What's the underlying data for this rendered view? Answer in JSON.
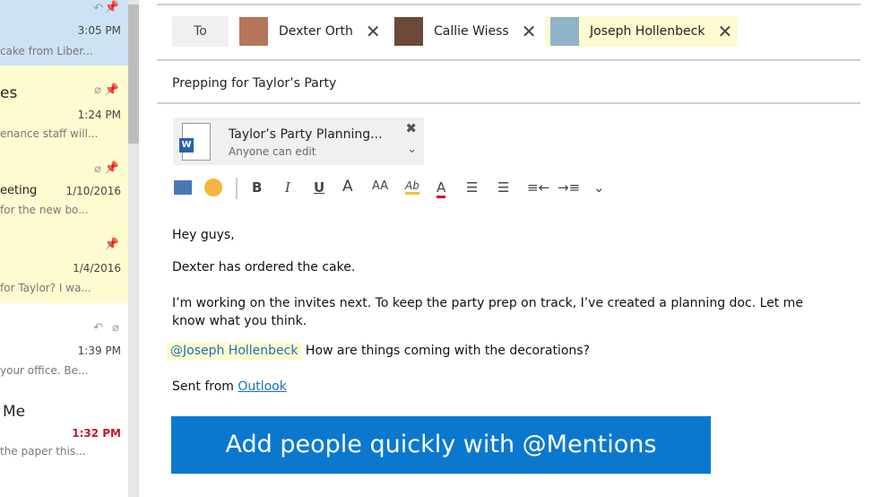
{
  "messages": [
    {
      "time": "3:05 PM",
      "preview": "cake from Liber..."
    },
    {
      "title": "es",
      "time": "1:24 PM",
      "preview": "enance staff will..."
    },
    {
      "title": "eeting",
      "time": "1/10/2016",
      "preview": "for the new bo..."
    },
    {
      "time": "1/4/2016",
      "preview": "for Taylor? I wa..."
    },
    {
      "time": "1:39 PM",
      "preview": "your office. Be..."
    },
    {
      "title": "Me",
      "time": "1:32 PM",
      "preview": "the paper this..."
    }
  ],
  "compose": {
    "to_label": "To",
    "recipients": [
      "Dexter Orth",
      "Callie Wiess",
      "Joseph Hollenbeck"
    ],
    "subject": "Prepping for Taylor’s Party",
    "attachment": {
      "name": "Taylor’s Party Planning...",
      "permission": "Anyone can edit"
    },
    "toolbar": [
      "B",
      "I",
      "U",
      "A",
      "AA",
      "Ab",
      "A"
    ],
    "body": {
      "greeting": "Hey guys,",
      "line1": "Dexter has ordered the cake.",
      "line2": "I’m working on the invites next. To keep the party prep on track, I’ve created a planning doc. Let me know what you think.",
      "mention": "@Joseph Hollenbeck",
      "mention_text": " How are things coming with the decorations?",
      "sent_from": "Sent from ",
      "sent_link": "Outlook"
    }
  },
  "banner": "Add people quickly with @Mentions"
}
